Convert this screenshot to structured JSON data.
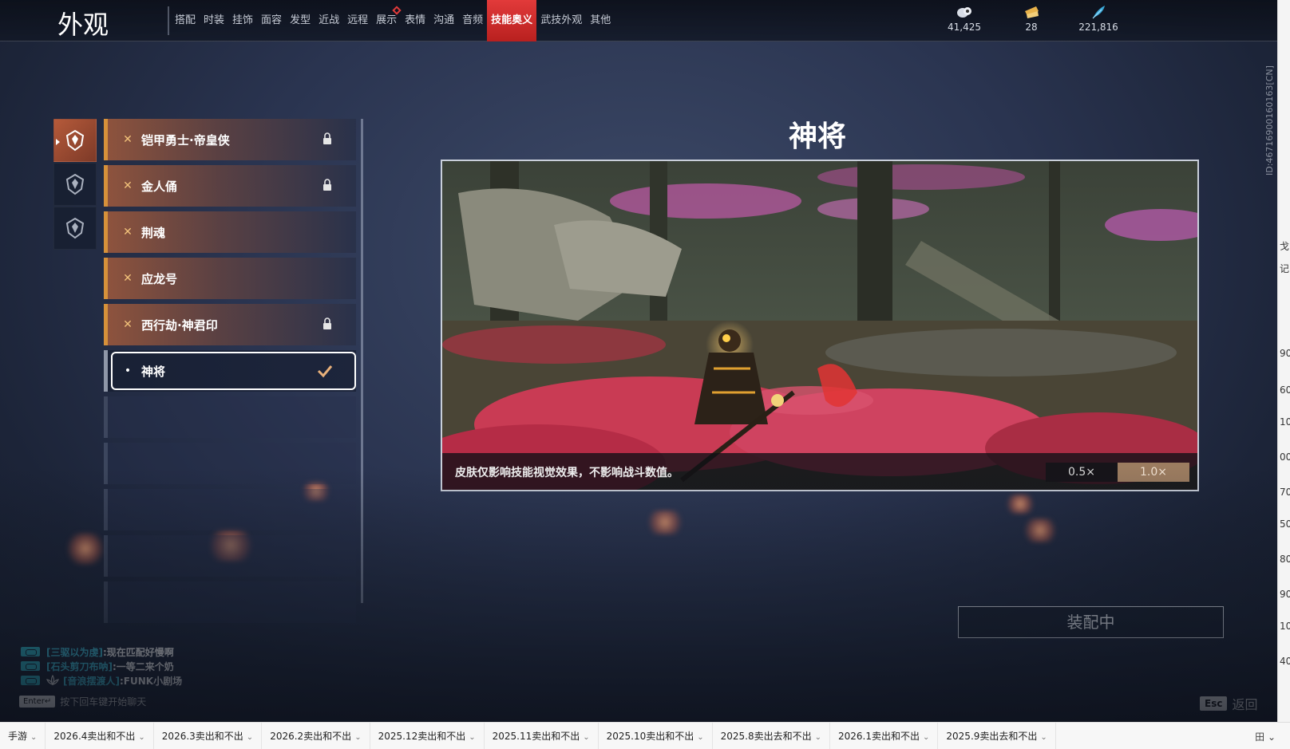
{
  "header": {
    "title": "外观",
    "tabs": [
      {
        "label": "搭配",
        "active": false,
        "badge": false
      },
      {
        "label": "时装",
        "active": false,
        "badge": false
      },
      {
        "label": "挂饰",
        "active": false,
        "badge": false
      },
      {
        "label": "面容",
        "active": false,
        "badge": false
      },
      {
        "label": "发型",
        "active": false,
        "badge": false
      },
      {
        "label": "近战",
        "active": false,
        "badge": false
      },
      {
        "label": "远程",
        "active": false,
        "badge": false
      },
      {
        "label": "展示",
        "active": false,
        "badge": true
      },
      {
        "label": "表情",
        "active": false,
        "badge": false
      },
      {
        "label": "沟通",
        "active": false,
        "badge": false
      },
      {
        "label": "音频",
        "active": false,
        "badge": false
      },
      {
        "label": "技能奥义",
        "active": true,
        "badge": false
      },
      {
        "label": "武技外观",
        "active": false,
        "badge": false
      },
      {
        "label": "其他",
        "active": false,
        "badge": false
      }
    ],
    "currencies": [
      {
        "icon": "coin-pile-icon",
        "value": "41,425"
      },
      {
        "icon": "ticket-icon",
        "value": "28"
      },
      {
        "icon": "feather-icon",
        "value": "221,816"
      }
    ]
  },
  "categories": [
    {
      "icon": "skill-emblem-icon",
      "active": true
    },
    {
      "icon": "skill-emblem-icon",
      "active": false
    },
    {
      "icon": "skill-emblem-icon",
      "active": false
    }
  ],
  "skins": [
    {
      "name": "铠甲勇士·帝皇侠",
      "locked": true,
      "selected": false
    },
    {
      "name": "金人俑",
      "locked": true,
      "selected": false
    },
    {
      "name": "荆魂",
      "locked": false,
      "selected": false
    },
    {
      "name": "应龙号",
      "locked": false,
      "selected": false
    },
    {
      "name": "西行劫·神君印",
      "locked": true,
      "selected": false
    },
    {
      "name": "神将",
      "locked": false,
      "selected": true
    }
  ],
  "preview": {
    "title": "神将",
    "note": "皮肤仅影响技能视觉效果，不影响战斗数值。",
    "speeds": [
      "0.5×",
      "1.0×"
    ],
    "active_speed": "1.0×"
  },
  "equip_button": "装配中",
  "chat": {
    "lines": [
      {
        "name": "[三驱以为虔]",
        "msg": ":现在匹配好慢啊",
        "lotus": false
      },
      {
        "name": "[石头剪刀布呐]",
        "msg": ":一等二来个奶",
        "lotus": false
      },
      {
        "name": "[音浪摆渡人]",
        "msg": ":FUNK小剧场",
        "lotus": true
      }
    ],
    "enter_key": "Enter↵",
    "hint": "按下回车键开始聊天"
  },
  "footer": {
    "esc_key": "Esc",
    "back_label": "返回"
  },
  "build_id": "ID:46716900160163[CN]",
  "right_strip": [
    "戈",
    "记",
    "90",
    "60",
    "10",
    "00",
    "70",
    "50",
    "80",
    "90",
    "10",
    "40"
  ],
  "sheet_tabs": [
    "手游",
    "2026.4卖出和不出",
    "2026.3卖出和不出",
    "2026.2卖出和不出",
    "2025.12卖出和不出",
    "2025.11卖出和不出",
    "2025.10卖出和不出",
    "2025.8卖出去和不出",
    "2026.1卖出和不出",
    "2025.9卖出去和不出"
  ],
  "sheet_menu": "田 ⌄",
  "colors": {
    "accent_red": "#e23a3a",
    "skin_border_orange": "#d6913a",
    "chat_name": "#3fc6e0"
  }
}
